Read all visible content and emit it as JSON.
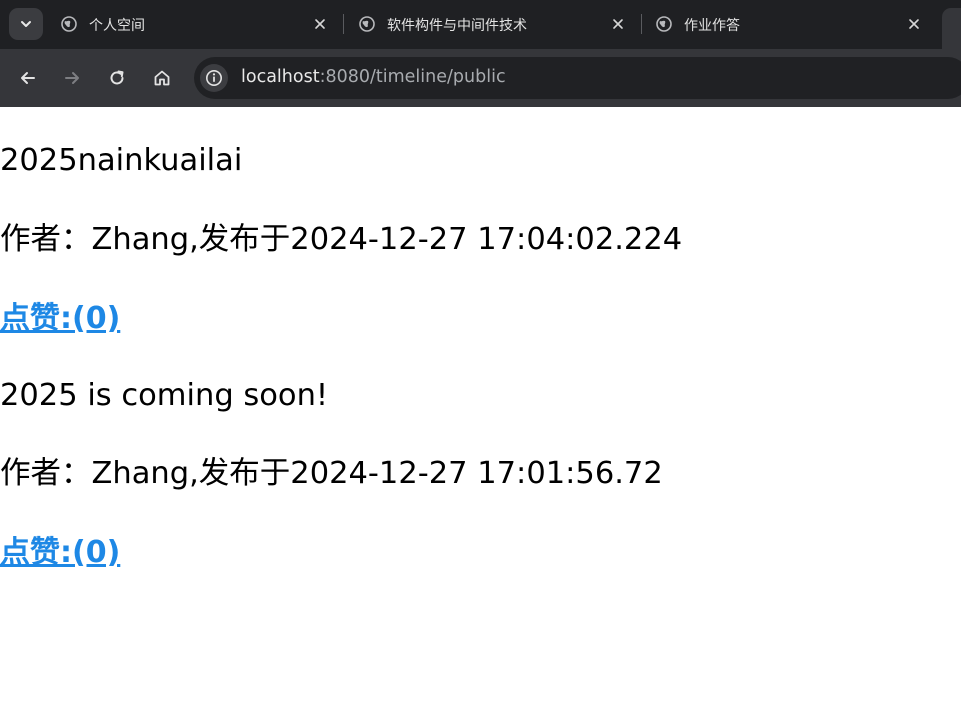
{
  "browser": {
    "tabs": [
      {
        "title": "个人空间"
      },
      {
        "title": "软件构件与中间件技术"
      },
      {
        "title": "作业作答"
      }
    ],
    "url": {
      "host": "localhost",
      "path": ":8080/timeline/public"
    }
  },
  "posts": [
    {
      "title": "2025nainkuailai",
      "meta": "作者：Zhang,发布于2024-12-27 17:04:02.224",
      "like": "点赞:(0)"
    },
    {
      "title": "2025 is coming soon!",
      "meta": "作者：Zhang,发布于2024-12-27 17:01:56.72",
      "like": "点赞:(0)"
    }
  ],
  "colors": {
    "tabstrip": "#1f2023",
    "toolbar": "#35363a",
    "omnibox": "#202124",
    "link": "#1e88e5"
  },
  "icons": [
    "tab-search-icon",
    "globe-icon",
    "close-icon",
    "back-icon",
    "forward-icon",
    "reload-icon",
    "home-icon",
    "site-info-icon"
  ]
}
